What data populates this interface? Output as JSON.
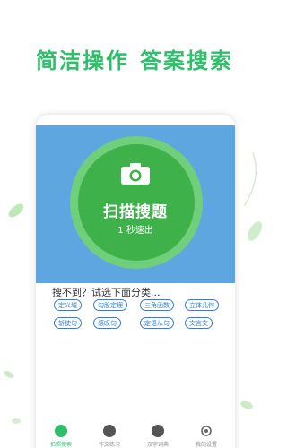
{
  "tagline": {
    "left": "简洁操作",
    "right": "答案搜索"
  },
  "scan": {
    "title": "扫描搜题",
    "subtitle": "1 秒速出"
  },
  "prompt": "搜不到？试选下面分类...",
  "tags": [
    "定义域",
    "勾股定理",
    "三角函数",
    "立体几何",
    "斩使句",
    "感叹句",
    "定语从句",
    "文言文"
  ],
  "tabbar": [
    {
      "label": "拍照搜索",
      "icon": "camera-icon",
      "active": true
    },
    {
      "label": "作文练习",
      "icon": "essay-icon",
      "active": false
    },
    {
      "label": "汉字词典",
      "icon": "dictionary-icon",
      "active": false
    },
    {
      "label": "我的设置",
      "icon": "gear-icon",
      "active": false
    }
  ],
  "colors": {
    "brand_green": "#2fbf6a",
    "panel_blue": "#5ea6e0",
    "tag_blue": "#2f7fd6"
  }
}
